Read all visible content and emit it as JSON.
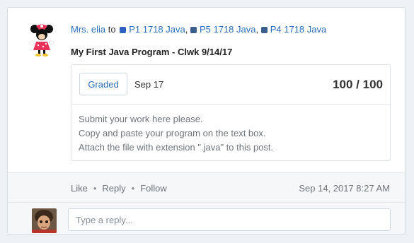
{
  "post": {
    "author": "Mrs. elia",
    "to_word": "to",
    "sections": [
      {
        "label": "P1 1718 Java",
        "color": "#2f5fbf"
      },
      {
        "label": "P5 1718 Java",
        "color": "#3a5f8f"
      },
      {
        "label": "P4 1718 Java",
        "color": "#3a5f8f"
      }
    ],
    "title": "My First Java Program - Clwk 9/14/17",
    "graded_label": "Graded",
    "due_date": "Sep 17",
    "score": "100 / 100",
    "body_lines": [
      "Submit your work here please.",
      "Copy and paste your program on the text box.",
      "Attach the file with extension \".java\" to this post."
    ],
    "actions": {
      "like": "Like",
      "reply": "Reply",
      "follow": "Follow",
      "separator": "•"
    },
    "timestamp": "Sep 14, 2017 8:27 AM"
  },
  "reply": {
    "placeholder": "Type a reply..."
  },
  "icons": {
    "author_avatar": "minnie-mouse-avatar",
    "reply_avatar": "user-photo-avatar"
  }
}
